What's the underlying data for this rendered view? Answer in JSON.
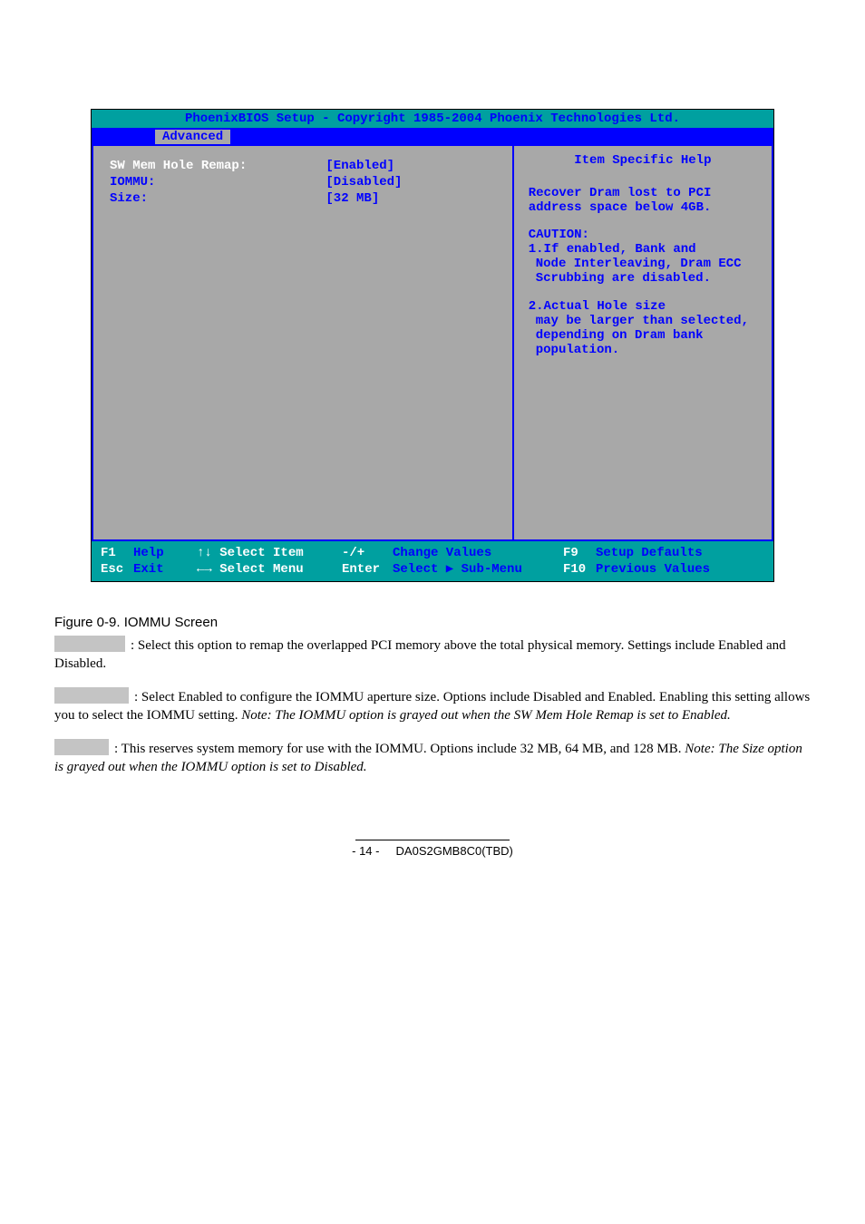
{
  "bios": {
    "title": "PhoenixBIOS Setup - Copyright 1985-2004 Phoenix Technologies Ltd.",
    "menu_tab": "Advanced",
    "items": [
      {
        "label": "SW Mem Hole Remap:",
        "selected": true,
        "value": "[Enabled]"
      },
      {
        "label": "IOMMU:",
        "selected": false,
        "value": "[Disabled]"
      },
      {
        "label": "Size:",
        "selected": false,
        "value": "[32 MB]"
      }
    ],
    "help": {
      "title": "Item Specific Help",
      "p1": "Recover Dram lost to PCI address space below 4GB.",
      "caution": "CAUTION:",
      "c1a": "1.If enabled, Bank and",
      "c1b": "Node Interleaving, Dram ECC Scrubbing are disabled.",
      "c2a": "2.Actual Hole size",
      "c2b": "may be larger than selected, depending on Dram bank population."
    },
    "footer": {
      "f1": "F1",
      "f1t": "Help",
      "f1s": "↑↓ Select Item",
      "cv": "-/+",
      "cvt": "Change Values",
      "f9": "F9",
      "f9t": "Setup Defaults",
      "esc": "Esc",
      "esct": "Exit",
      "escs": "←→ Select Menu",
      "ent": "Enter",
      "entt": "Select ▶ Sub-Menu",
      "f10": "F10",
      "f10t": "Previous Values"
    }
  },
  "doc": {
    "figcap": "Figure 0-9. IOMMU Screen",
    "p1": ": Select this option to remap the overlapped PCI memory above the total physical memory. Settings include Enabled and Disabled.",
    "p2_lead": ": ",
    "p2_text": "Select Enabled to configure the IOMMU aperture size. Options include Disabled and Enabled. Enabling this setting allows you to select the IOMMU setting.",
    "p2_note": "Note: The IOMMU option is grayed out when the SW Mem Hole Remap is set to Enabled.",
    "p3_lead": ": ",
    "p3_text": "This reserves system memory for use with the IOMMU. Options include 32 MB, 64 MB, and 128 MB.",
    "p3_note": "Note: The Size option is grayed out when the IOMMU option is set to Disabled."
  },
  "footer": {
    "pg": "- 14 -",
    "doc": "DA0S2GMB8C0(TBD)"
  }
}
